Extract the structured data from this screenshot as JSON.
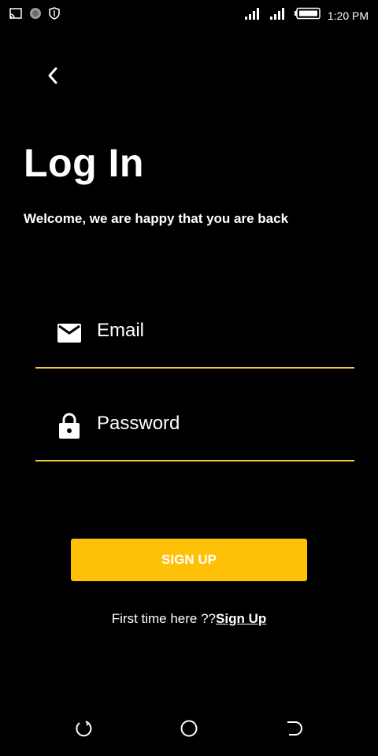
{
  "status_bar": {
    "time": "1:20 PM",
    "icons": [
      "cast-icon",
      "circle-notification-icon",
      "shield-icon",
      "signal-icon",
      "signal-icon",
      "battery-icon"
    ]
  },
  "header": {
    "back_icon": "chevron-left-icon",
    "title": "Log In",
    "subtitle": "Welcome, we are happy that you are back"
  },
  "form": {
    "email": {
      "icon": "mail-icon",
      "placeholder": "Email",
      "value": ""
    },
    "password": {
      "icon": "lock-icon",
      "placeholder": "Password",
      "value": ""
    },
    "submit_label": "SIGN UP"
  },
  "footer": {
    "prompt": "First time here ??",
    "link": "Sign Up"
  },
  "nav_bar": {
    "icons": [
      "recent-apps-icon",
      "home-icon",
      "back-icon"
    ]
  },
  "colors": {
    "background": "#000000",
    "accent": "#ffc107",
    "underline": "#f5c842",
    "text": "#ffffff"
  }
}
